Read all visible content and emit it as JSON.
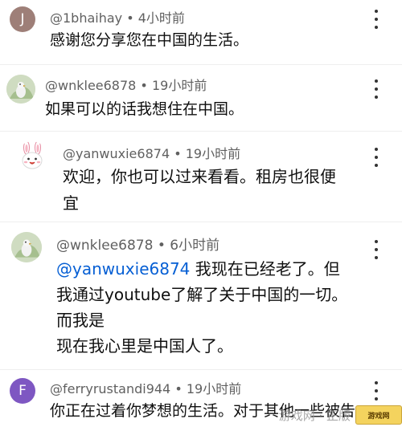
{
  "comments": [
    {
      "avatar_letter": "J",
      "avatar_color": "#9e7f78",
      "author": "@1bhaihay",
      "time": "4小时前",
      "lines": [
        "感谢您分享您在中国的生活。"
      ]
    },
    {
      "avatar_icon": "bird-avatar-icon",
      "author": "@wnklee6878",
      "time": "19小时前",
      "lines": [
        "如果可以的话我想住在中国。"
      ]
    },
    {
      "avatar_icon": "rabbit-avatar-icon",
      "author": "@yanwuxie6874",
      "time": "19小时前",
      "lines": [
        "欢迎，你也可以过来看看。租房也很便",
        "宜"
      ]
    },
    {
      "avatar_icon": "bird-avatar-icon",
      "author": "@wnklee6878",
      "time": "6小时前",
      "mention": "@yanwuxie6874",
      "lines": [
        " 我现在已经老了。但",
        "我通过youtube了解了关于中国的一切。",
        "而我是",
        "现在我心里是中国人了。"
      ]
    },
    {
      "avatar_letter": "F",
      "avatar_color": "#7e57c2",
      "author": "@ferryrustandi944",
      "time": "19小时前",
      "lines": [
        "你正在过着你梦想的生活。对于其他一些被告"
      ]
    }
  ],
  "separator": " • ",
  "watermark": {
    "text": "游戏网 · 正版",
    "logo_text": "游戏网"
  }
}
